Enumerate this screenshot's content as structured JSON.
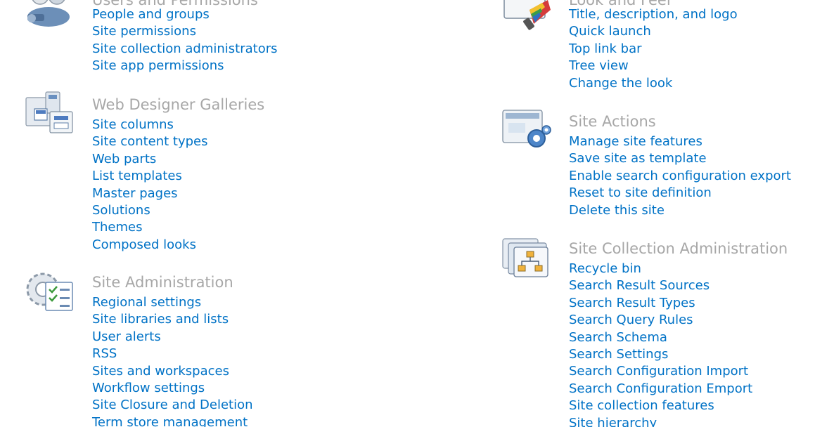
{
  "accent_link_color": "#0072c6",
  "heading_color": "#a7a7a7",
  "sections": {
    "users_permissions": {
      "title": "Users and Permissions",
      "icon": "users-permissions-icon",
      "links": [
        "People and groups",
        "Site permissions",
        "Site collection administrators",
        "Site app permissions"
      ]
    },
    "look_and_feel": {
      "title": "Look and Feel",
      "icon": "look-and-feel-icon",
      "links": [
        "Title, description, and logo",
        "Quick launch",
        "Top link bar",
        "Tree view",
        "Change the look"
      ]
    },
    "web_designer_galleries": {
      "title": "Web Designer Galleries",
      "icon": "web-designer-galleries-icon",
      "links": [
        "Site columns",
        "Site content types",
        "Web parts",
        "List templates",
        "Master pages",
        "Solutions",
        "Themes",
        "Composed looks"
      ]
    },
    "site_actions": {
      "title": "Site Actions",
      "icon": "site-actions-icon",
      "links": [
        "Manage site features",
        "Save site as template",
        "Enable search configuration export",
        "Reset to site definition",
        "Delete this site"
      ]
    },
    "site_administration": {
      "title": "Site Administration",
      "icon": "site-administration-icon",
      "links": [
        "Regional settings",
        "Site libraries and lists",
        "User alerts",
        "RSS",
        "Sites and workspaces",
        "Workflow settings",
        "Site Closure and Deletion",
        "Term store management"
      ]
    },
    "site_collection_administration": {
      "title": "Site Collection Administration",
      "icon": "site-collection-administration-icon",
      "links": [
        "Recycle bin",
        "Search Result Sources",
        "Search Result Types",
        "Search Query Rules",
        "Search Schema",
        "Search Settings",
        "Search Configuration Import",
        "Search Configuration Emport",
        "Site collection features",
        "Site hierarchy"
      ]
    }
  }
}
